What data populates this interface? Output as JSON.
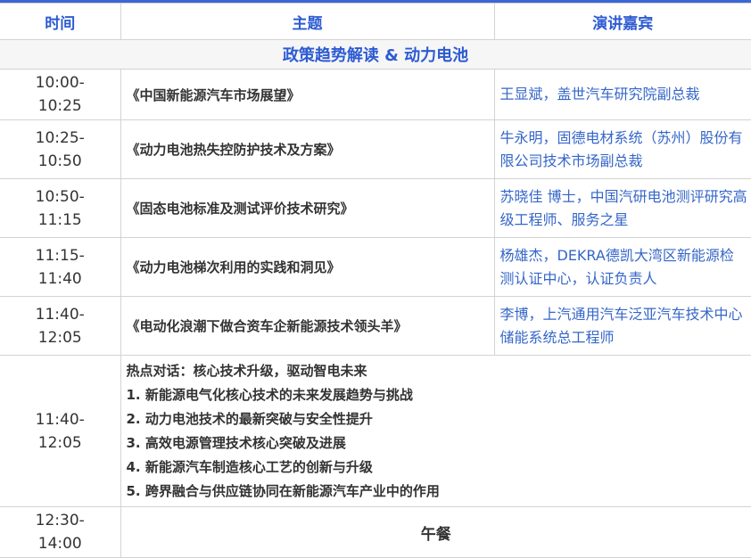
{
  "header": {
    "time": "时间",
    "topic": "主题",
    "speaker": "演讲嘉宾"
  },
  "section_title": "政策趋势解读 & 动力电池",
  "sessions": [
    {
      "time_start": "10:00-",
      "time_end": "10:25",
      "topic": "《中国新能源汽车市场展望》",
      "speaker": "王显斌，盖世汽车研究院副总裁"
    },
    {
      "time_start": "10:25-",
      "time_end": "10:50",
      "topic": "《动力电池热失控防护技术及方案》",
      "speaker": "牛永明，固德电材系统（苏州）股份有限公司技术市场副总裁"
    },
    {
      "time_start": "10:50-",
      "time_end": "11:15",
      "topic": "《固态电池标准及测试评价技术研究》",
      "speaker": "苏晓佳 博士，中国汽研电池测评研究高级工程师、服务之星"
    },
    {
      "time_start": "11:15-",
      "time_end": "11:40",
      "topic": "《动力电池梯次利用的实践和洞见》",
      "speaker": "杨雄杰，DEKRA德凯大湾区新能源检测认证中心，认证负责人"
    },
    {
      "time_start": "11:40-",
      "time_end": "12:05",
      "topic": "《电动化浪潮下做合资车企新能源技术领头羊》",
      "speaker": "李博，上汽通用汽车泛亚汽车技术中心储能系统总工程师"
    }
  ],
  "panel": {
    "time_start": "11:40-",
    "time_end": "12:05",
    "title": "热点对话：核心技术升级，驱动智电未来",
    "items": [
      "1. 新能源电气化核心技术的未来发展趋势与挑战",
      "2. 动力电池技术的最新突破与安全性提升",
      "3. 高效电源管理技术核心突破及进展",
      "4. 新能源汽车制造核心工艺的创新与升级",
      "5. 跨界融合与供应链协同在新能源汽车产业中的作用"
    ]
  },
  "lunch": {
    "time_start": "12:30-",
    "time_end": "14:00",
    "label": "午餐"
  }
}
